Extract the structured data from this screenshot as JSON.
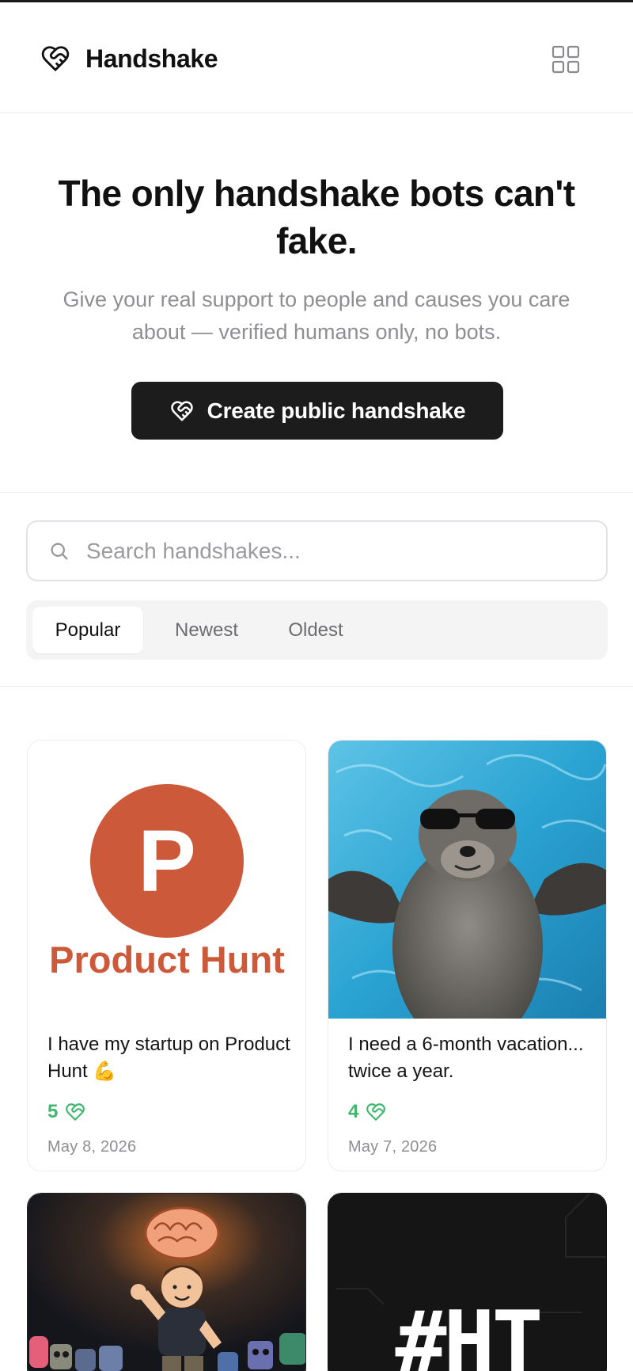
{
  "header": {
    "brand_name": "Handshake",
    "brand_icon": "heart-handshake-icon",
    "menu_icon": "grid-icon"
  },
  "hero": {
    "title": "The only handshake bots can't fake.",
    "subtitle": "Give your real support to people and causes you care about — verified humans only, no bots.",
    "cta_label": "Create public handshake",
    "cta_icon": "heart-handshake-icon"
  },
  "search": {
    "placeholder": "Search handshakes...",
    "value": "",
    "icon": "search-icon"
  },
  "sort_tabs": [
    {
      "label": "Popular",
      "active": true
    },
    {
      "label": "Newest",
      "active": false
    },
    {
      "label": "Oldest",
      "active": false
    }
  ],
  "cards": [
    {
      "title": "I have my startup on Product Hunt 💪",
      "count": "5",
      "date": "May 8, 2026",
      "image_logo_letter": "P",
      "image_logo_text": "Product Hunt"
    },
    {
      "title": "I need a 6-month vacation... twice a year.",
      "count": "4",
      "date": "May 7, 2026"
    },
    {
      "title": "",
      "count": "",
      "date": ""
    },
    {
      "title": "",
      "count": "",
      "date": "",
      "image_text": "#HT"
    }
  ],
  "colors": {
    "accent_green": "#3fb86e",
    "product_hunt_orange": "#cc5a3a",
    "cta_background": "#1c1c1c"
  }
}
